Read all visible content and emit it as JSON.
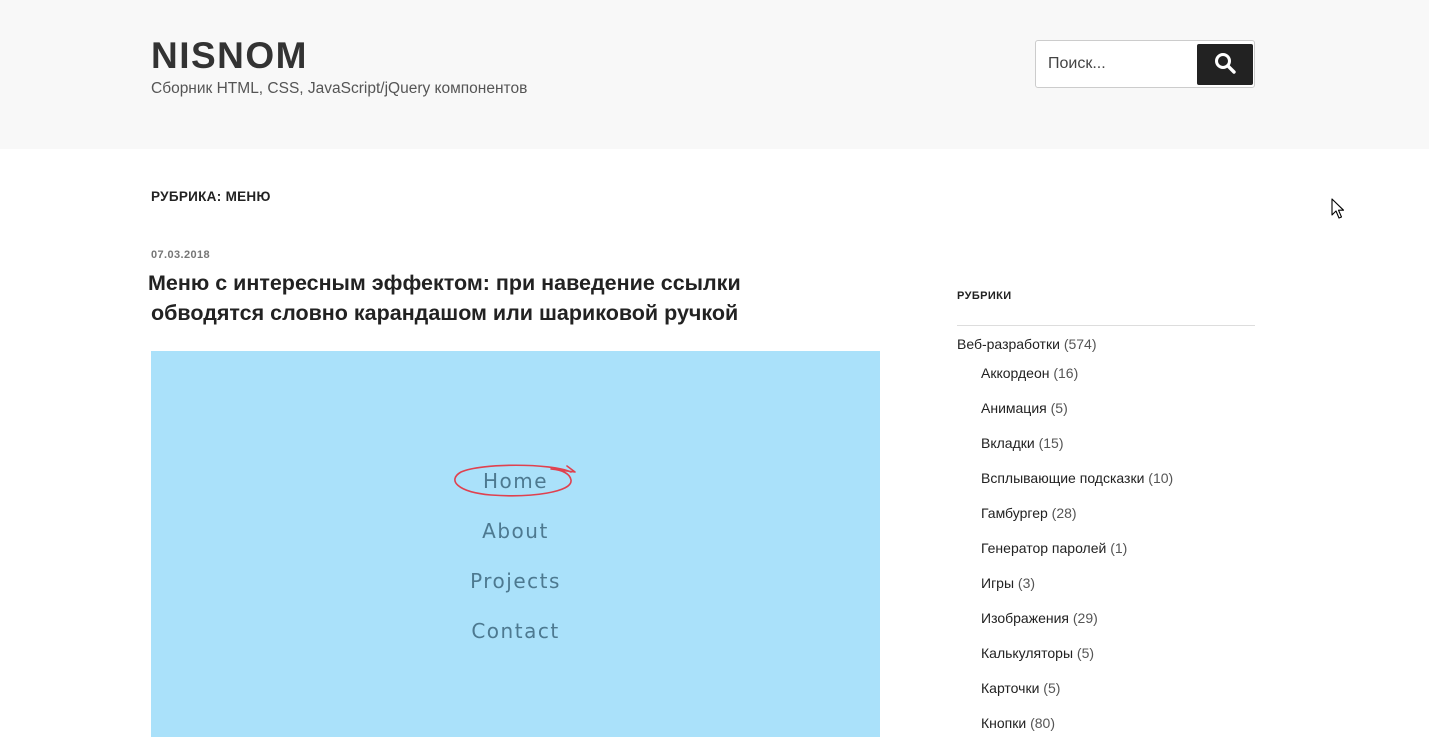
{
  "header": {
    "site_title": "NISNOM",
    "site_description": "Сборник HTML, CSS, JavaScript/jQuery компонентов",
    "search_placeholder": "Поиск...",
    "search_icon": "search-icon"
  },
  "archive": {
    "title": "РУБРИКА: МЕНЮ"
  },
  "post": {
    "date": "07.03.2018",
    "title_line1": "Меню с интересным эффектом: при наведение ссылки",
    "title_line2": "обводятся словно карандашом или шариковой ручкой",
    "demo_menu": [
      "Home",
      "About",
      "Projects",
      "Contact"
    ],
    "demo_background": "#aae1fa",
    "demo_link_color": "#4d7990",
    "scribble_color": "#e0414f"
  },
  "sidebar": {
    "widget_title": "РУБРИКИ",
    "categories": [
      {
        "name": "Веб-разработки",
        "count": "(574)"
      },
      {
        "name": "Аккордеон",
        "count": "(16)"
      },
      {
        "name": "Анимация",
        "count": "(5)"
      },
      {
        "name": "Вкладки",
        "count": "(15)"
      },
      {
        "name": "Всплывающие подсказки",
        "count": "(10)"
      },
      {
        "name": "Гамбургер",
        "count": "(28)"
      },
      {
        "name": "Генератор паролей",
        "count": "(1)"
      },
      {
        "name": "Игры",
        "count": "(3)"
      },
      {
        "name": "Изображения",
        "count": "(29)"
      },
      {
        "name": "Калькуляторы",
        "count": "(5)"
      },
      {
        "name": "Карточки",
        "count": "(5)"
      },
      {
        "name": "Кнопки",
        "count": "(80)"
      }
    ]
  }
}
